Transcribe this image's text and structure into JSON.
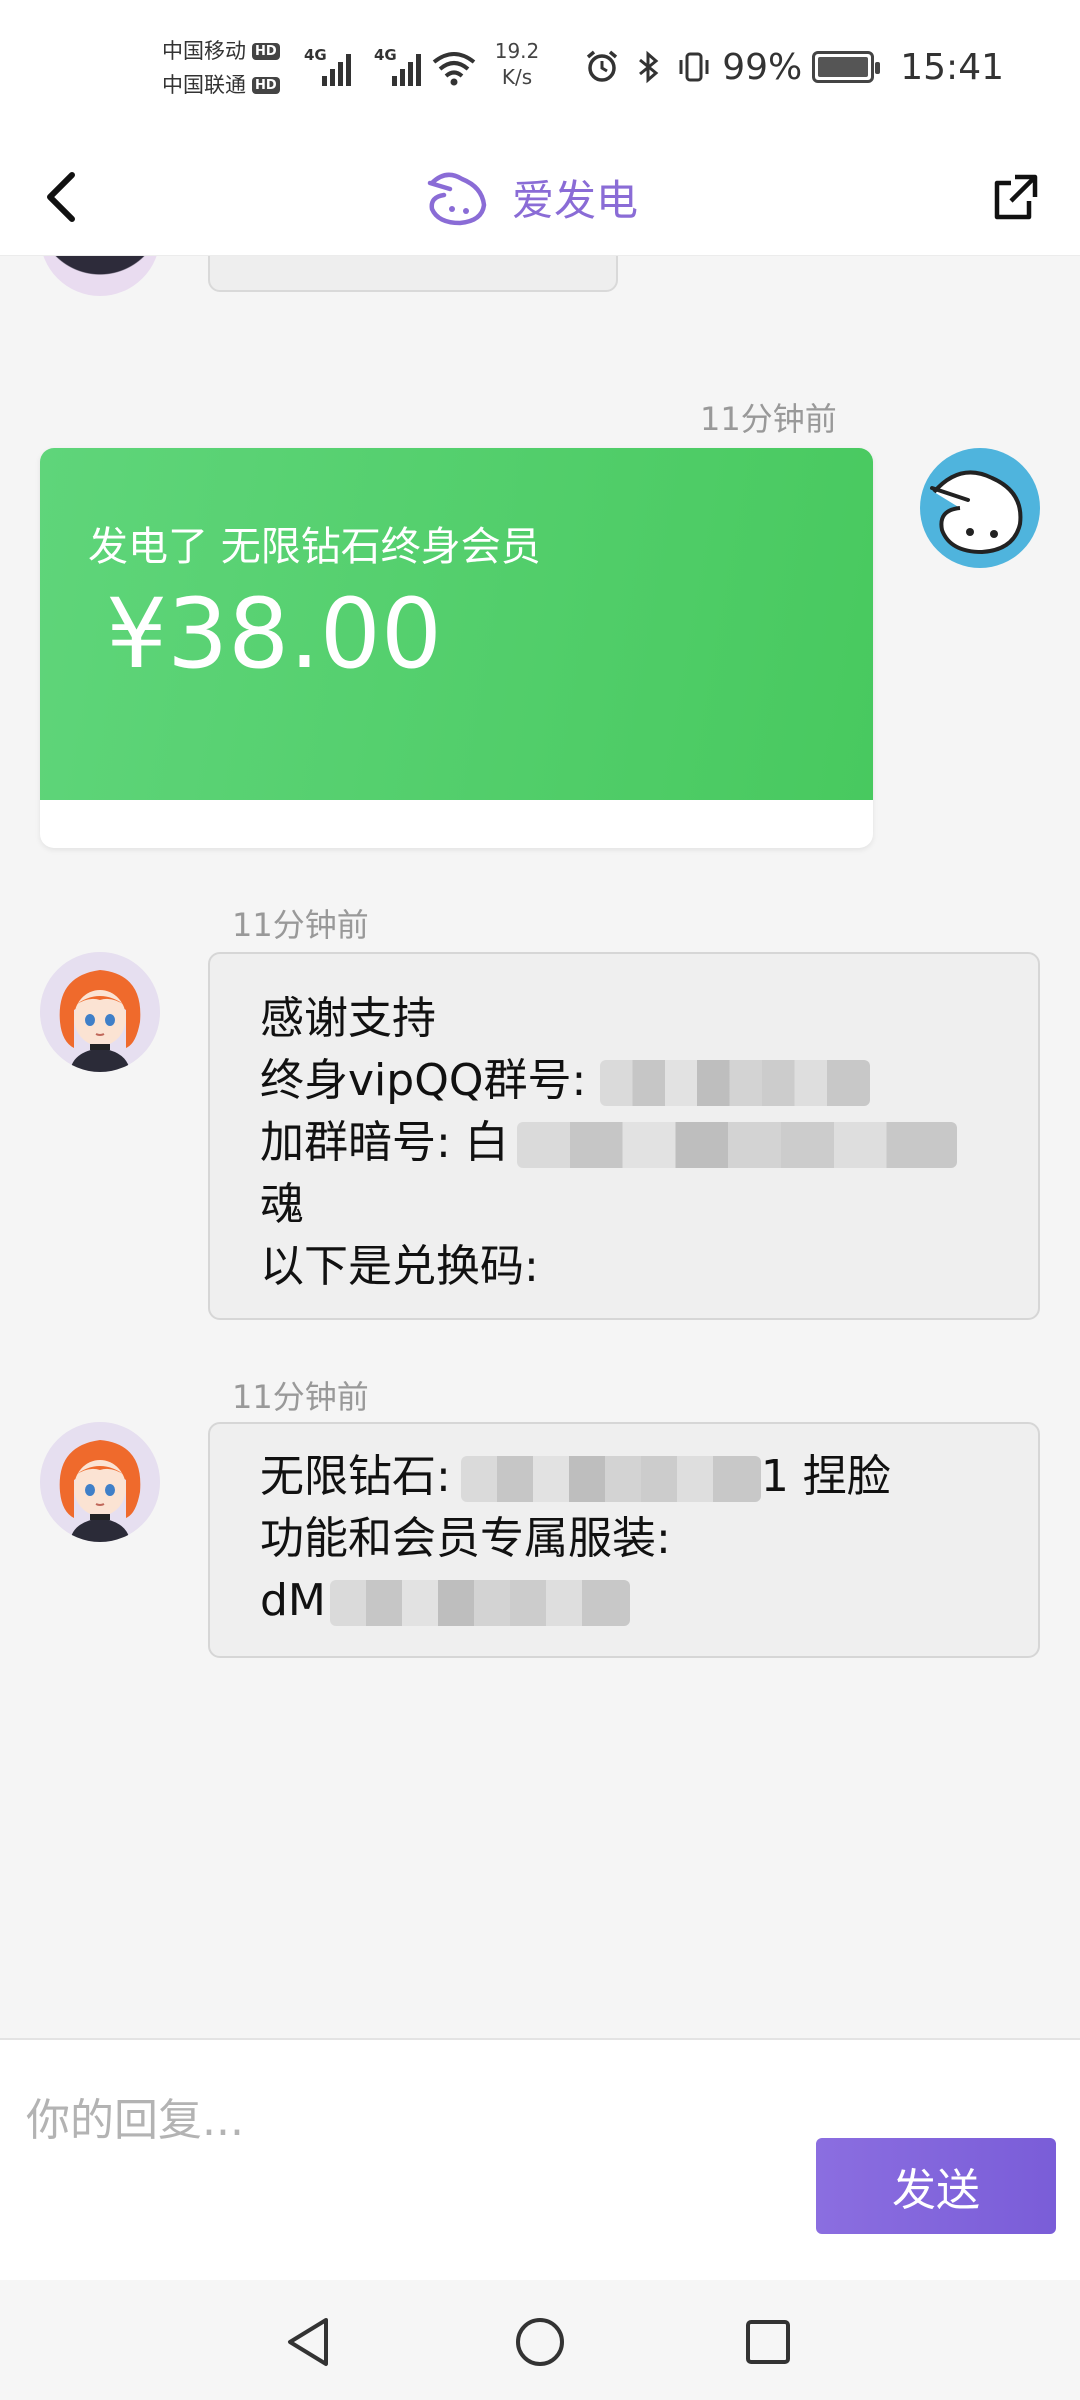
{
  "status_bar": {
    "carrier_1": "中国移动",
    "carrier_2": "中国联通",
    "hd_label": "HD",
    "network_1": "4G",
    "network_2": "4G",
    "net_speed_value": "19.2",
    "net_speed_unit": "K/s",
    "battery_percent": "99%",
    "time": "15:41"
  },
  "header": {
    "title": "爱发电",
    "back_icon": "chevron-left-icon",
    "share_icon": "external-link-icon"
  },
  "messages": [
    {
      "timestamp": "11分钟前",
      "type": "support_card",
      "title": "发电了 无限钻石终身会员",
      "amount": "¥38.00"
    },
    {
      "timestamp": "11分钟前",
      "type": "text",
      "lines": [
        "感谢支持",
        "终身vipQQ群号:",
        "加群暗号: 白",
        "魂",
        "以下是兑换码:"
      ]
    },
    {
      "timestamp": "11分钟前",
      "type": "text",
      "lines": [
        "无限钻石:",
        "1 捏脸",
        "功能和会员专属服装:",
        "dM"
      ]
    }
  ],
  "input": {
    "placeholder": "你的回复...",
    "send_label": "发送"
  },
  "nav": {
    "back_icon": "triangle-back-icon",
    "home_icon": "circle-home-icon",
    "recent_icon": "square-recent-icon"
  },
  "colors": {
    "accent": "#8a6cd6",
    "support_green": "#4cca63",
    "send_button": "#7d60da"
  }
}
